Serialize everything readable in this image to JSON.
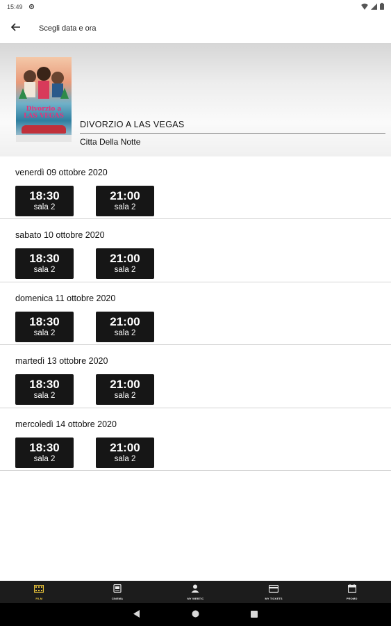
{
  "status_bar": {
    "time": "15:49"
  },
  "app_bar": {
    "title": "Scegli data e ora"
  },
  "movie": {
    "title": "DIVORZIO A LAS VEGAS",
    "cinema": "Citta Della Notte",
    "poster_text": [
      "Divorzio a",
      "LAS VEGAS"
    ]
  },
  "days": [
    {
      "label": "venerdì 09 ottobre 2020",
      "slots": [
        {
          "time": "18:30",
          "room": "sala 2"
        },
        {
          "time": "21:00",
          "room": "sala 2"
        }
      ]
    },
    {
      "label": "sabato 10 ottobre 2020",
      "slots": [
        {
          "time": "18:30",
          "room": "sala 2"
        },
        {
          "time": "21:00",
          "room": "sala 2"
        }
      ]
    },
    {
      "label": "domenica 11 ottobre 2020",
      "slots": [
        {
          "time": "18:30",
          "room": "sala 2"
        },
        {
          "time": "21:00",
          "room": "sala 2"
        }
      ]
    },
    {
      "label": "martedì 13 ottobre 2020",
      "slots": [
        {
          "time": "18:30",
          "room": "sala 2"
        },
        {
          "time": "21:00",
          "room": "sala 2"
        }
      ]
    },
    {
      "label": "mercoledì 14 ottobre 2020",
      "slots": [
        {
          "time": "18:30",
          "room": "sala 2"
        },
        {
          "time": "21:00",
          "room": "sala 2"
        }
      ]
    }
  ],
  "bottom_nav": {
    "items": [
      {
        "label": "FILM",
        "icon": "film-icon",
        "active": true
      },
      {
        "label": "CINEMA",
        "icon": "cinema-icon",
        "active": false
      },
      {
        "label": "MY WEBTIC",
        "icon": "person-icon",
        "active": false
      },
      {
        "label": "MY TICKETS",
        "icon": "credit-card-icon",
        "active": false
      },
      {
        "label": "PROMO",
        "icon": "calendar-icon",
        "active": false
      }
    ]
  },
  "colors": {
    "accent": "#e8c33a",
    "slot_bg": "#161616",
    "nav_bg": "#1c1c1c"
  }
}
